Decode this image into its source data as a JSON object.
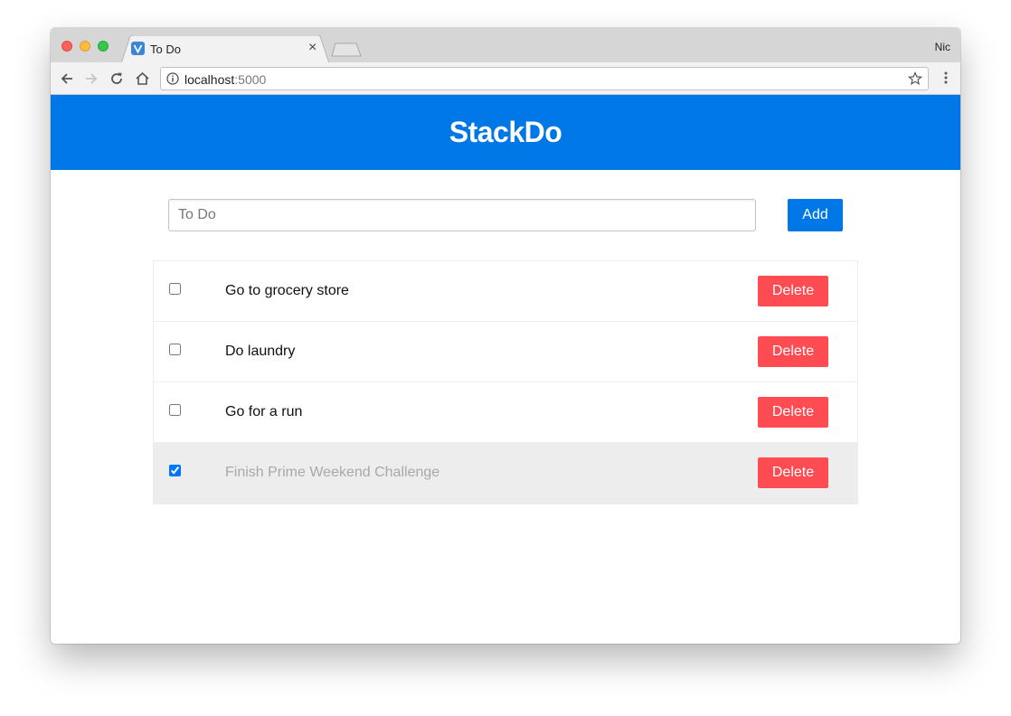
{
  "browser": {
    "tab_title": "To Do",
    "tab_close": "×",
    "profile_name": "Nic",
    "url_host": "localhost",
    "url_port": ":5000",
    "icons": [
      "back-arrow-icon",
      "forward-arrow-icon",
      "reload-icon",
      "home-icon",
      "info-icon",
      "star-icon",
      "menu-icon",
      "favicon-icon"
    ]
  },
  "app": {
    "brand": "StackDo",
    "brand_color": "#0077e6",
    "input_placeholder": "To Do",
    "add_label": "Add",
    "delete_color": "#ff4b52",
    "todos": [
      {
        "text": "Go to grocery store",
        "checked": false,
        "delete_label": "Delete"
      },
      {
        "text": "Do laundry",
        "checked": false,
        "delete_label": "Delete"
      },
      {
        "text": "Go for a run",
        "checked": false,
        "delete_label": "Delete"
      },
      {
        "text": "Finish Prime Weekend Challenge",
        "checked": true,
        "delete_label": "Delete"
      }
    ]
  }
}
